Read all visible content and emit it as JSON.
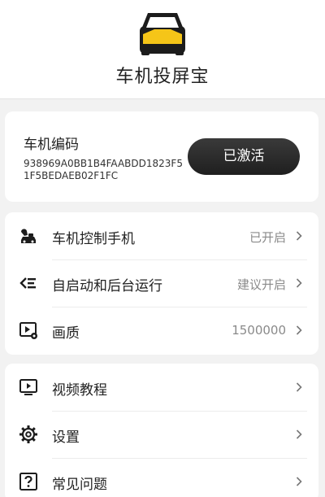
{
  "app": {
    "title": "车机投屏宝"
  },
  "device": {
    "label": "车机编码",
    "code": "938969A0BB1B4FAABDD1823F51F5BEDAEB02F1FC",
    "status_button": "已激活"
  },
  "settings": [
    {
      "label": "车机控制手机",
      "value": "已开启",
      "icon": "car-phone-icon"
    },
    {
      "label": "自启动和后台运行",
      "value": "建议开启",
      "icon": "autostart-icon"
    },
    {
      "label": "画质",
      "value": "1500000",
      "icon": "video-quality-icon"
    }
  ],
  "help": [
    {
      "label": "视频教程",
      "icon": "video-tutorial-icon"
    },
    {
      "label": "设置",
      "icon": "gear-icon"
    },
    {
      "label": "常见问题",
      "icon": "question-icon"
    }
  ],
  "colors": {
    "logo_yellow": "#f5c518",
    "logo_dark": "#1c1c1c",
    "button_dark": "#2a2a2a"
  }
}
